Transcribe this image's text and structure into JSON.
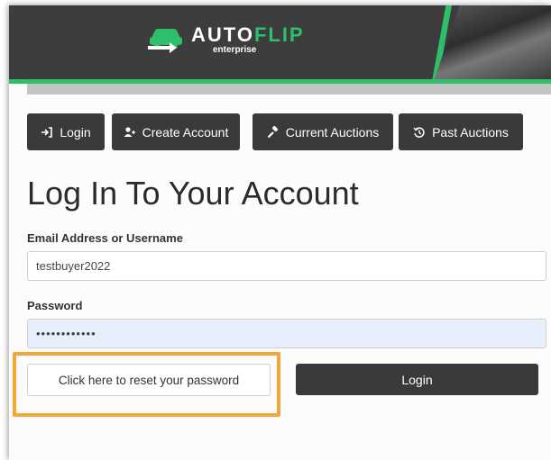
{
  "header": {
    "logo_word_1": "AUTO",
    "logo_word_2": "FLIP",
    "logo_sub": "enterprise",
    "logo_icon": "car-arrow-icon"
  },
  "nav": {
    "items": [
      {
        "label": "Login",
        "icon": "sign-in-icon"
      },
      {
        "label": "Create Account",
        "icon": "user-plus-icon"
      },
      {
        "label": "Current Auctions",
        "icon": "gavel-icon"
      },
      {
        "label": "Past Auctions",
        "icon": "history-icon"
      }
    ]
  },
  "form": {
    "title": "Log In To Your Account",
    "email_label": "Email Address or Username",
    "email_value": "testbuyer2022",
    "password_label": "Password",
    "password_value": "••••••••••••",
    "reset_label": "Click here to reset your password",
    "login_label": "Login"
  },
  "colors": {
    "accent_green": "#2fbf6a",
    "dark": "#3a3a3a",
    "highlight_orange": "#f6a53a",
    "autofill_blue": "#e8effc"
  }
}
